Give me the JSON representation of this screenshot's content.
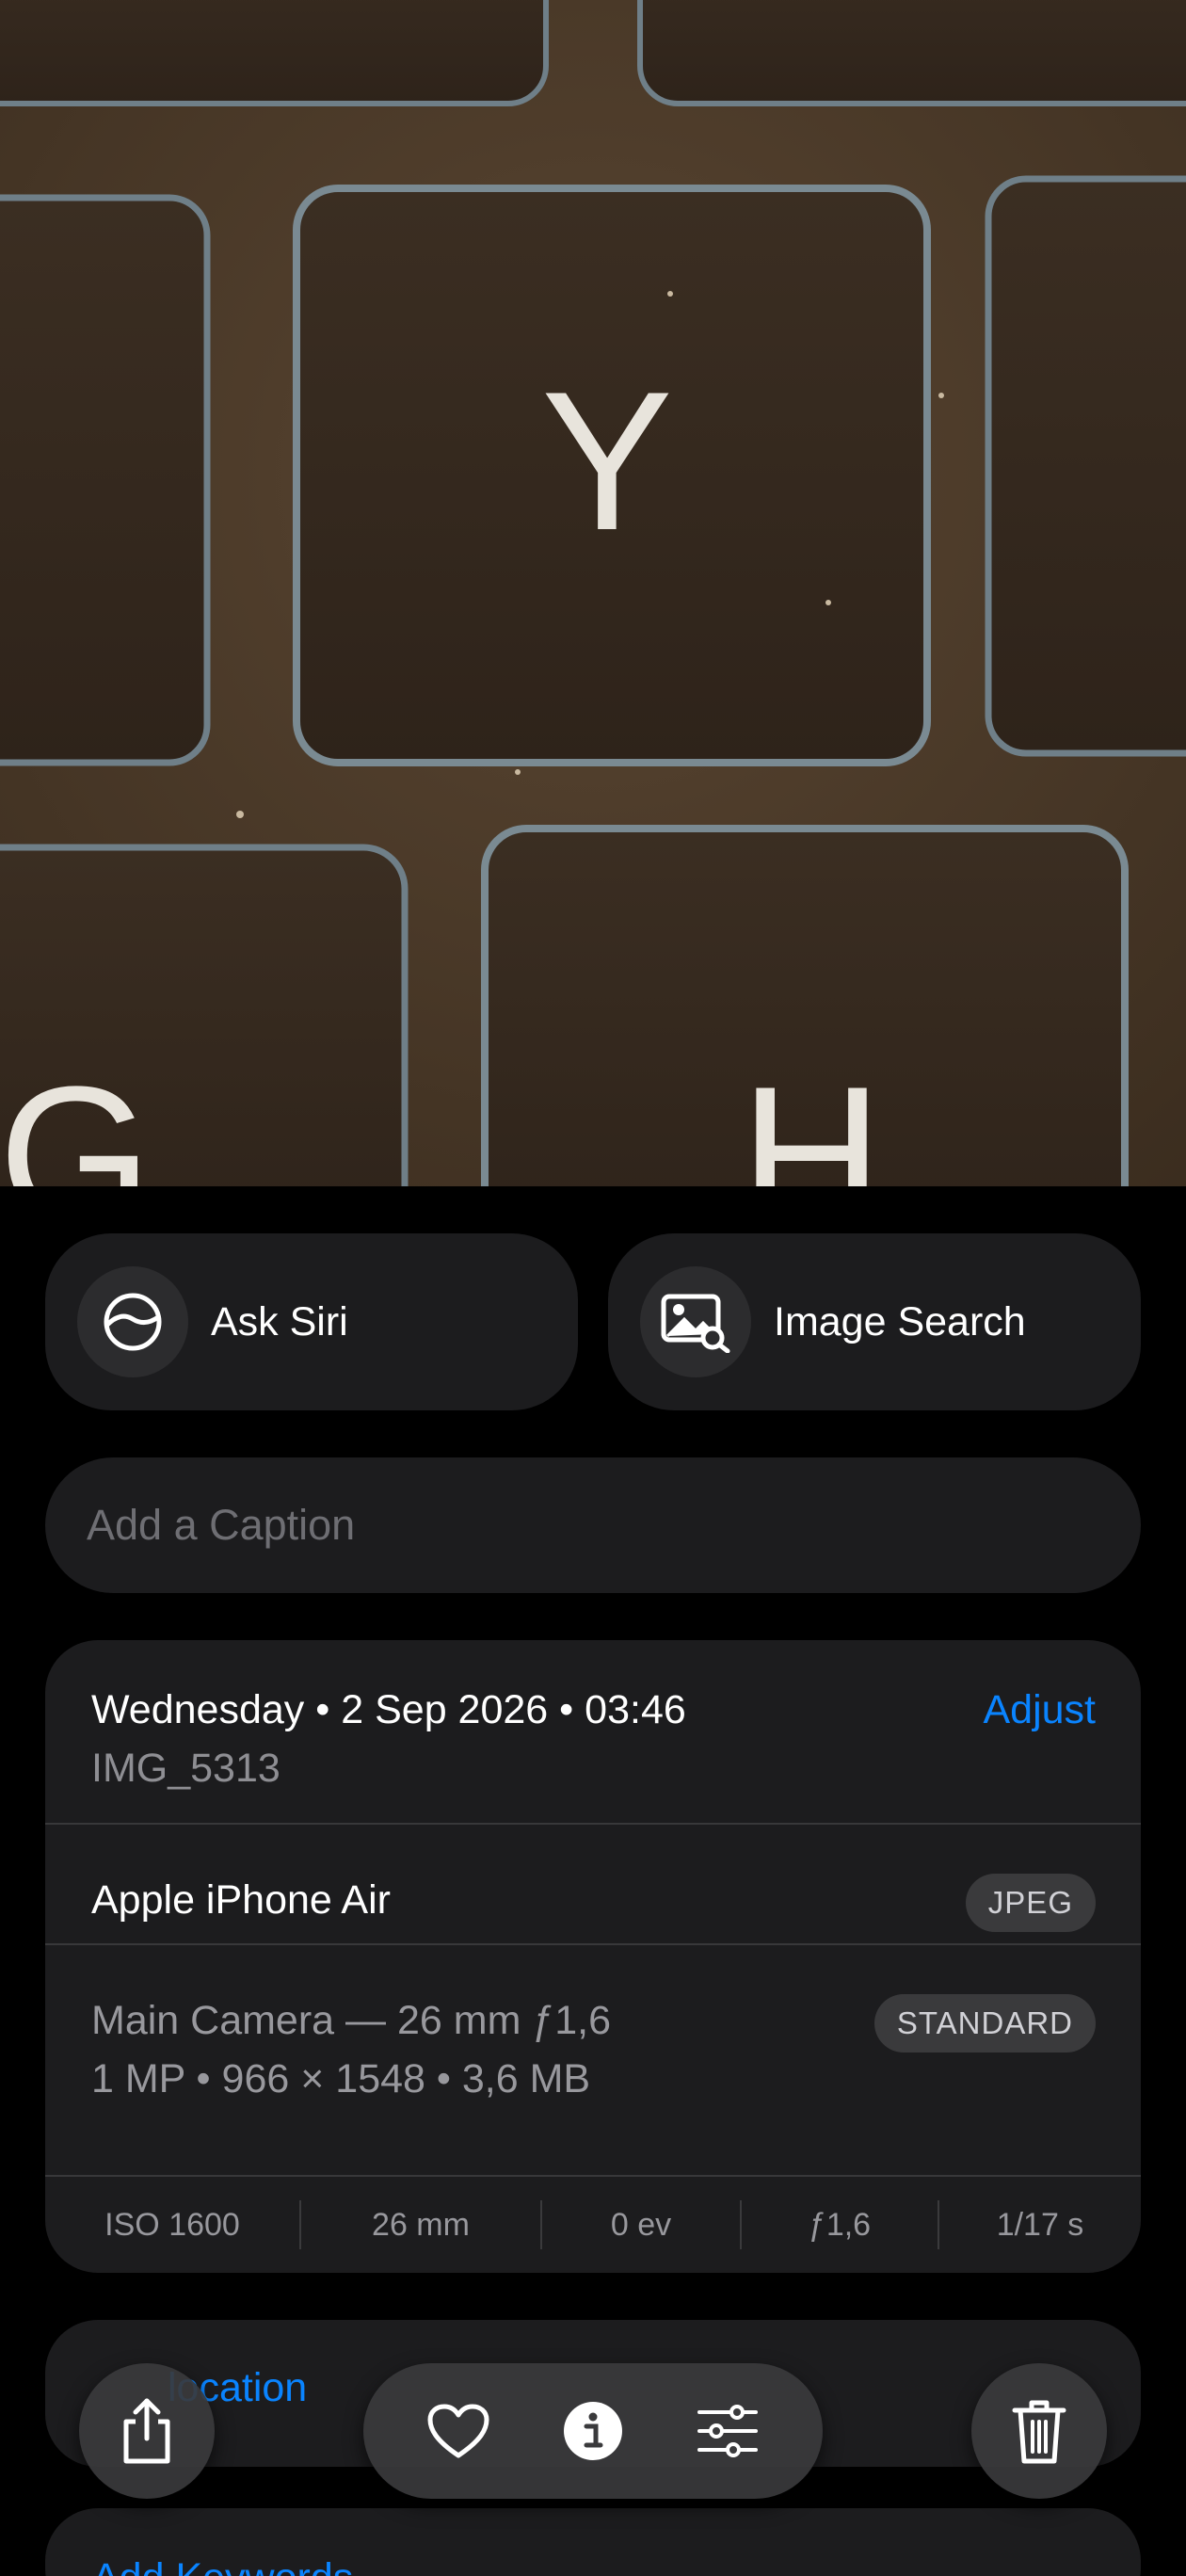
{
  "photo": {
    "keys": [
      "Y",
      "G",
      "H"
    ]
  },
  "actions": {
    "ask_siri": "Ask Siri",
    "image_search": "Image Search"
  },
  "caption": {
    "placeholder": "Add a Caption"
  },
  "info": {
    "date": "Wednesday • 2 Sep 2026 • 03:46",
    "filename": "IMG_5313",
    "adjust": "Adjust",
    "device": "Apple iPhone Air",
    "format_badge": "JPEG",
    "camera": "Main Camera — 26 mm ƒ1,6",
    "details": "1 MP • 966 × 1548 • 3,6 MB",
    "mode_badge": "STANDARD",
    "exif": {
      "iso": "ISO 1600",
      "focal": "26 mm",
      "ev": "0 ev",
      "aperture": "ƒ1,6",
      "shutter": "1/17 s"
    }
  },
  "location": {
    "label": "location"
  },
  "keywords": {
    "label": "Add Keywords"
  },
  "toolbar": {
    "icons": [
      "share-icon",
      "heart-icon",
      "info-icon",
      "sliders-icon",
      "trash-icon"
    ]
  },
  "colors": {
    "accent": "#0a84ff",
    "card": "#1c1c1e",
    "background": "#000000"
  }
}
